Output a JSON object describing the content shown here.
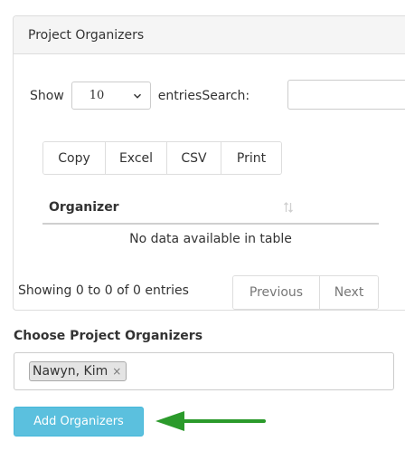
{
  "panel": {
    "title": "Project Organizers"
  },
  "length": {
    "show_label": "Show",
    "selected": "10",
    "entries_label": "entries"
  },
  "search": {
    "label": "Search:",
    "value": ""
  },
  "buttons": [
    {
      "label": "Copy",
      "icon": null
    },
    {
      "label": "Excel"
    },
    {
      "label": "CSV"
    },
    {
      "label": "Print"
    }
  ],
  "table": {
    "columns": [
      {
        "label": "Organizer",
        "sort_icon": "sort-icon"
      }
    ],
    "empty_message": "No data available in table"
  },
  "info": {
    "text": "Showing 0 to 0 of 0 entries"
  },
  "pagination": {
    "previous_label": "Previous",
    "next_label": "Next"
  },
  "choose": {
    "label": "Choose Project Organizers",
    "selected": [
      {
        "name": "Nawyn, Kim",
        "remove_glyph": "×"
      }
    ]
  },
  "add_button": {
    "label": "Add Organizers",
    "color": "#5bc0de"
  },
  "annotation": {
    "arrow_color": "#2b9a2b",
    "icon": "arrow-left-icon"
  }
}
